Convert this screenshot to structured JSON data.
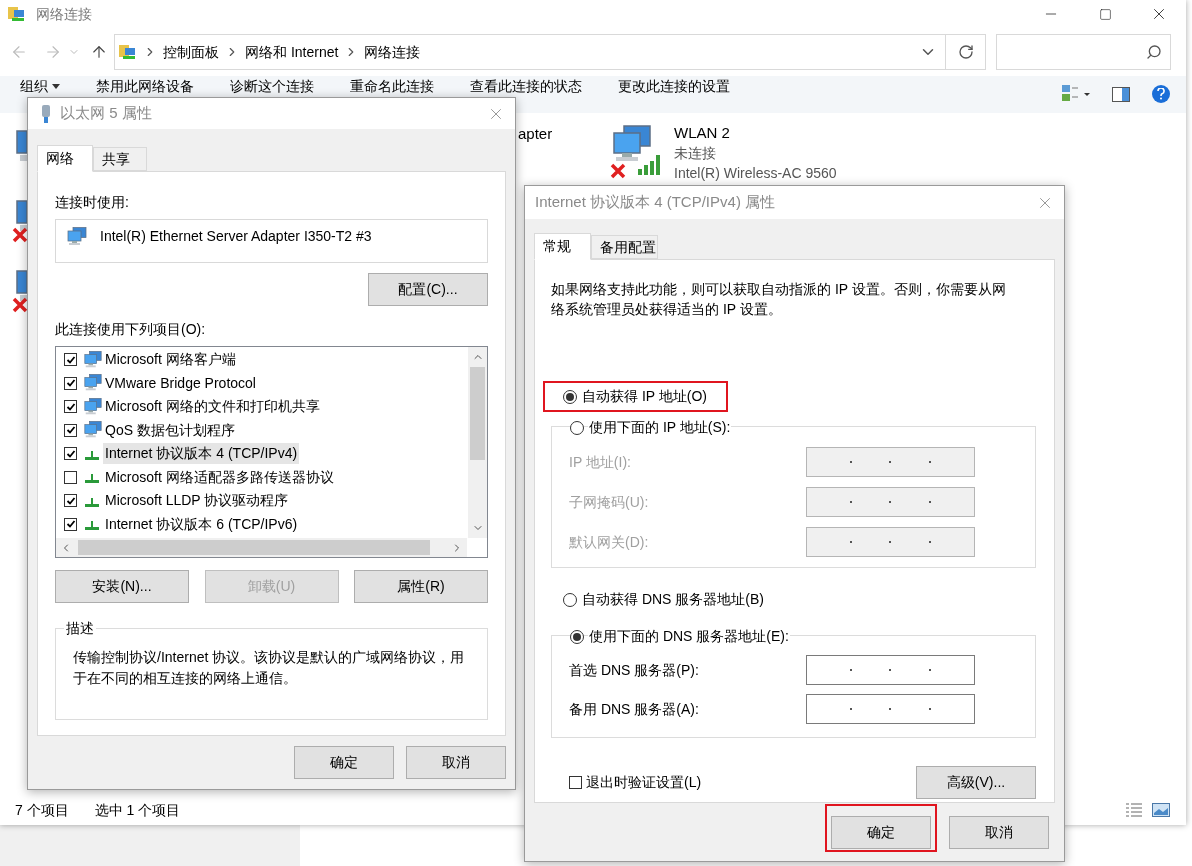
{
  "explorer": {
    "title": "网络连接",
    "breadcrumb": [
      "控制面板",
      "网络和 Internet",
      "网络连接"
    ],
    "toolbar": [
      {
        "label": "组织",
        "dropdown": true
      },
      {
        "label": "禁用此网络设备",
        "dropdown": false
      },
      {
        "label": "诊断这个连接",
        "dropdown": false
      },
      {
        "label": "重命名此连接",
        "dropdown": false
      },
      {
        "label": "查看此连接的状态",
        "dropdown": false
      },
      {
        "label": "更改此连接的设置",
        "dropdown": false
      }
    ],
    "left_items": [
      {
        "disconnected": false
      },
      {
        "disconnected": true
      },
      {
        "disconnected": true
      }
    ],
    "partial_name": "apter",
    "connection": {
      "name": "WLAN 2",
      "status": "未连接",
      "device": "Intel(R) Wireless-AC 9560",
      "disconnected": true
    },
    "status_bar": [
      "7 个项目",
      "选中 1 个项目"
    ]
  },
  "adapter_dialog": {
    "title": "以太网 5 属性",
    "tabs": [
      {
        "label": "网络",
        "selected": true
      },
      {
        "label": "共享",
        "selected": false
      }
    ],
    "connect_using_label": "连接时使用:",
    "adapter": "Intel(R) Ethernet Server Adapter I350-T2 #3",
    "configure_button": "配置(C)...",
    "items_label": "此连接使用下列项目(O):",
    "items": [
      {
        "label": "Microsoft 网络客户端",
        "checked": true,
        "selected": false,
        "kind": "service"
      },
      {
        "label": "VMware Bridge Protocol",
        "checked": true,
        "selected": false,
        "kind": "service"
      },
      {
        "label": "Microsoft 网络的文件和打印机共享",
        "checked": true,
        "selected": false,
        "kind": "service"
      },
      {
        "label": "QoS 数据包计划程序",
        "checked": true,
        "selected": false,
        "kind": "service"
      },
      {
        "label": "Internet 协议版本 4 (TCP/IPv4)",
        "checked": true,
        "selected": true,
        "kind": "protocol"
      },
      {
        "label": "Microsoft 网络适配器多路传送器协议",
        "checked": false,
        "selected": false,
        "kind": "protocol"
      },
      {
        "label": "Microsoft LLDP 协议驱动程序",
        "checked": true,
        "selected": false,
        "kind": "protocol"
      },
      {
        "label": "Internet 协议版本 6 (TCP/IPv6)",
        "checked": true,
        "selected": false,
        "kind": "protocol"
      }
    ],
    "buttons": [
      {
        "label": "安装(N)...",
        "disabled": false
      },
      {
        "label": "卸载(U)",
        "disabled": true
      },
      {
        "label": "属性(R)",
        "disabled": false
      }
    ],
    "description_label": "描述",
    "description": "传输控制协议/Internet 协议。该协议是默认的广域网络协议，用于在不同的相互连接的网络上通信。",
    "footer_buttons": [
      "确定",
      "取消"
    ]
  },
  "ipv4_dialog": {
    "title": "Internet 协议版本 4 (TCP/IPv4) 属性",
    "tabs": [
      {
        "label": "常规",
        "selected": true
      },
      {
        "label": "备用配置",
        "selected": false
      }
    ],
    "intro": "如果网络支持此功能，则可以获取自动指派的 IP 设置。否则，你需要从网络系统管理员处获得适当的 IP 设置。",
    "ip_auto": {
      "label": "自动获得 IP 地址(O)",
      "selected": true,
      "highlighted": true
    },
    "ip_manual": {
      "label": "使用下面的 IP 地址(S):",
      "selected": false,
      "highlighted": false
    },
    "ip_fields": [
      {
        "label": "IP 地址(I):",
        "disabled": true
      },
      {
        "label": "子网掩码(U):",
        "disabled": true
      },
      {
        "label": "默认网关(D):",
        "disabled": true
      }
    ],
    "dns_auto": {
      "label": "自动获得 DNS 服务器地址(B)",
      "selected": false,
      "highlighted": false
    },
    "dns_manual": {
      "label": "使用下面的 DNS 服务器地址(E):",
      "selected": true,
      "highlighted": false
    },
    "dns_fields": [
      {
        "label": "首选 DNS 服务器(P):",
        "disabled": false
      },
      {
        "label": "备用 DNS 服务器(A):",
        "disabled": false
      }
    ],
    "validate": {
      "label": "退出时验证设置(L)",
      "checked": false
    },
    "advanced_button": "高级(V)...",
    "footer_buttons": [
      {
        "label": "确定",
        "highlighted": true
      },
      {
        "label": "取消",
        "highlighted": false
      }
    ]
  }
}
